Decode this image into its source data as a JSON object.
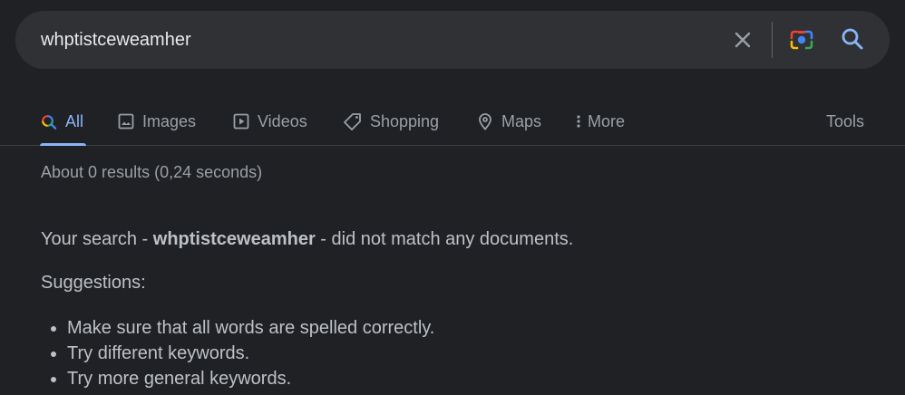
{
  "search": {
    "query": "whptistceweamher",
    "clear_icon": "close-icon",
    "lens_icon": "camera-lens-icon",
    "search_icon": "search-icon"
  },
  "tabs": [
    {
      "label": "All",
      "icon": "search-icon",
      "active": true
    },
    {
      "label": "Images",
      "icon": "image-icon"
    },
    {
      "label": "Videos",
      "icon": "video-icon"
    },
    {
      "label": "Shopping",
      "icon": "tag-icon"
    },
    {
      "label": "Maps",
      "icon": "map-pin-icon"
    },
    {
      "label": "More",
      "icon": "more-vert-icon"
    }
  ],
  "tools_label": "Tools",
  "results": {
    "stats": "About 0 results (0,24 seconds)",
    "message_prefix": "Your search - ",
    "message_query": "whptistceweamher",
    "message_suffix": " - did not match any documents.",
    "suggestions_title": "Suggestions:",
    "suggestions": [
      "Make sure that all words are spelled correctly.",
      "Try different keywords.",
      "Try more general keywords."
    ]
  },
  "colors": {
    "background": "#202124",
    "search_bar": "#303134",
    "accent": "#8ab4f8",
    "text": "#bdc1c6",
    "muted": "#9aa0a6"
  }
}
